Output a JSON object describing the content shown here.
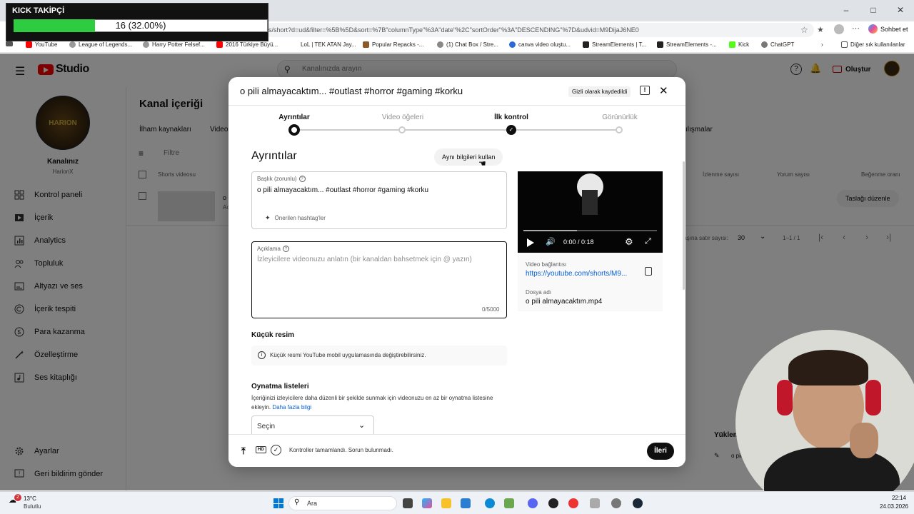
{
  "overlay": {
    "title": "KICK TAKİPÇİ",
    "value": "16 (32.00%)",
    "progress": 0.32
  },
  "browser": {
    "url": "s/short?d=ud&filter=%5B%5D&sort=%7B\"columnType\"%3A\"date\"%2C\"sortOrder\"%3A\"DESCENDING\"%7D&udvid=M9DijaJ6NE0",
    "chat_label": "Sohbet et",
    "bookmarks": [
      "YouTube",
      "League of Legends...",
      "Harry Potter Felsef...",
      "2016 Türkiye Büyü...",
      "LoL | TEK ATAN Jay...",
      "Popular Repacks -...",
      "(1) Chat Box / Stre...",
      "canva video oluştu...",
      "StreamElements | T...",
      "StreamElements -...",
      "Kick",
      "ChatGPT"
    ],
    "bookmarks_other": "Diğer sık kullanılanlar"
  },
  "studio": {
    "logo": "Studio",
    "search_placeholder": "Kanalınızda arayın",
    "create_label": "Oluştur",
    "channel_title": "Kanalınız",
    "channel_name": "HarionX",
    "page_title": "Kanal içeriği",
    "tabs": [
      "İlham kaynakları",
      "Video"
    ],
    "tab_right": "ılışmalar",
    "filter_label": "Filtre",
    "col_shorts": "Shorts videosu",
    "col_views": "İzlenme sayısı",
    "col_comments": "Yorum sayısı",
    "col_likes": "Beğenme oranı",
    "row_title_frag": "o",
    "row_sub_frag": "Ac",
    "edit_draft": "Taslağı düzenle",
    "rows_label": "Sayfa başına satır sayısı:",
    "rows_value": "30",
    "range": "1–1 / 1",
    "side_items": [
      "Kontrol paneli",
      "İçerik",
      "Analytics",
      "Topluluk",
      "Altyazı ve ses",
      "İçerik tespiti",
      "Para kazanma",
      "Özelleştirme",
      "Ses kitaplığı"
    ],
    "side_bottom": [
      "Ayarlar",
      "Geri bildirim gönder"
    ],
    "upload_popup_title": "Yükleme",
    "upload_popup_item": "o pil"
  },
  "dialog": {
    "title": "o pili almayacaktım... #outlast #horror #gaming #korku",
    "saved_chip": "Gizli olarak kaydedildi",
    "steps": [
      "Ayrıntılar",
      "Video öğeleri",
      "İlk kontrol",
      "Görünürlük"
    ],
    "section_title": "Ayrıntılar",
    "reuse_button": "Aynı bilgileri kullan",
    "title_label": "Başlık (zorunlu)",
    "title_value": "o pili almayacaktım... #outlast  #horror #gaming #korku",
    "hashtag_suggest": "Önerilen hashtag'ler",
    "desc_label": "Açıklama",
    "desc_placeholder": "İzleyicilere videonuzu anlatın (bir kanaldan bahsetmek için @ yazın)",
    "desc_counter": "0/5000",
    "thumb_title": "Küçük resim",
    "thumb_info": "Küçük resmi YouTube mobil uygulamasında değiştirebilirsiniz.",
    "playlist_title": "Oynatma listeleri",
    "playlist_desc": "İçeriğinizi izleyicilere daha düzenli bir şekilde sunmak için videonuzu en az bir oynatma listesine ekleyin.",
    "playlist_link": "Daha fazla bilgi",
    "playlist_select": "Seçin",
    "video_time": "0:00 / 0:18",
    "video_link_label": "Video bağlantısı",
    "video_link": "https://youtube.com/shorts/M9...",
    "file_label": "Dosya adı",
    "file_name": "o pili almayacaktım.mp4",
    "footer_status": "Kontroller tamamlandı. Sorun bulunmadı.",
    "next_button": "İleri"
  },
  "taskbar": {
    "weather_temp": "13°C",
    "weather_label": "Bulutlu",
    "weather_badge": "2",
    "search_label": "Ara",
    "time": "22:14",
    "date": "24.03.2026"
  },
  "colors": {
    "accent": "#065fd4",
    "progress": "#2ecc40",
    "youtube_red": "#ff0000"
  }
}
